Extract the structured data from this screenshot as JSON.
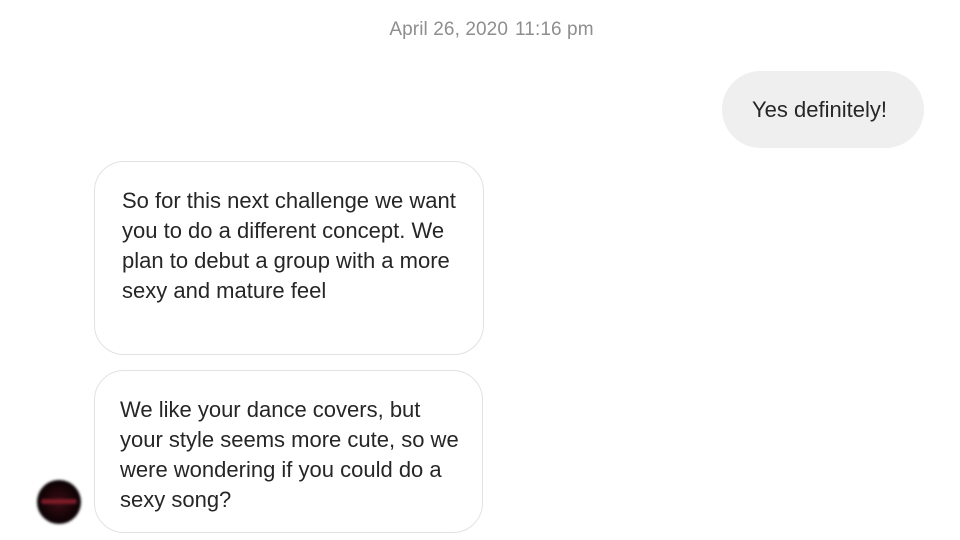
{
  "timestamp": {
    "date": "April 26, 2020",
    "time": "11:16 pm"
  },
  "messages": [
    {
      "direction": "outgoing",
      "text": "Yes definitely!"
    },
    {
      "direction": "incoming",
      "text": "So for this next challenge we want you to do a different concept. We plan to debut a group with a more sexy and mature feel"
    },
    {
      "direction": "incoming",
      "text": "We like your dance covers, but your style seems more cute, so we were wondering if you could do a sexy song?"
    }
  ],
  "colors": {
    "outgoing_bubble": "#efefef",
    "incoming_border": "#e2e2e2",
    "text": "#262626",
    "timestamp": "#8e8e8e"
  },
  "icons": {
    "sender_avatar": "avatar"
  }
}
